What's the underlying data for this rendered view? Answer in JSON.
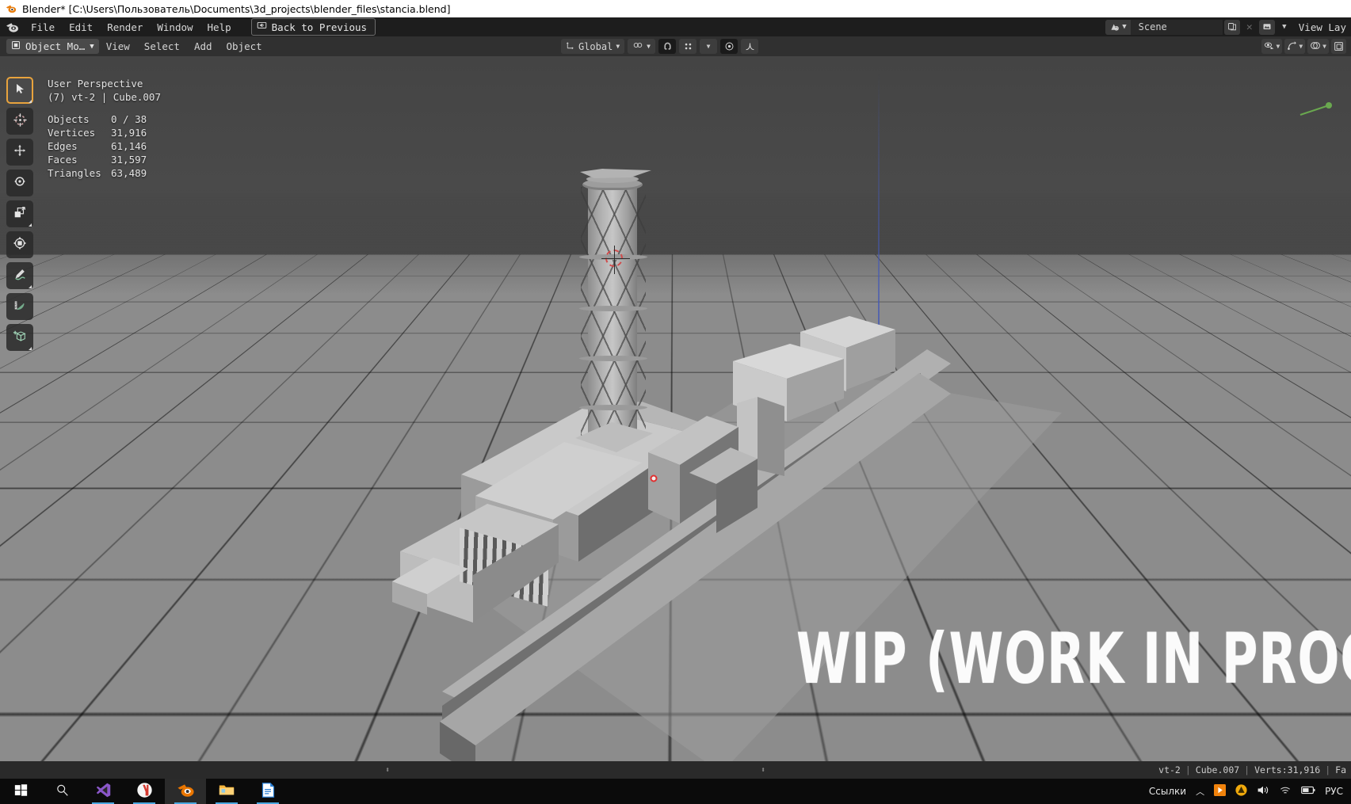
{
  "window": {
    "title": "Blender* [C:\\Users\\Пользователь\\Documents\\3d_projects\\blender_files\\stancia.blend]",
    "app_icon": "blender-logo-icon"
  },
  "topbar": {
    "logo_icon": "blender-logo-icon",
    "menus": [
      "File",
      "Edit",
      "Render",
      "Window",
      "Help"
    ],
    "back_button": {
      "label": "Back to Previous",
      "icon": "back-arrow-icon"
    },
    "scene": {
      "icon": "scene-icon",
      "dropdown_icon": "chevron-down-icon",
      "name": "Scene",
      "new_icon": "copy-icon",
      "remove_icon": "close-x-icon"
    },
    "view_layer": {
      "icon": "view-layer-icon",
      "dropdown_icon": "chevron-down-icon",
      "name": "View Lay"
    }
  },
  "viewport_header": {
    "mode": {
      "icon": "object-mode-icon",
      "label": "Object Mo…",
      "dropdown_icon": "chevron-down-icon"
    },
    "menus": [
      "View",
      "Select",
      "Add",
      "Object"
    ],
    "right_controls": [
      {
        "name": "visibility-icon",
        "dropdown": true
      },
      {
        "name": "gizmo-icon",
        "dropdown": true
      },
      {
        "name": "overlays-icon",
        "dropdown": true
      },
      {
        "name": "xray-toggle-icon",
        "dropdown": false
      }
    ]
  },
  "transform_bar": {
    "orientation_icon": "transform-orientation-icon",
    "orientation": "Global",
    "orientation_dropdown_icon": "chevron-down-icon",
    "pivot_icon": "pivot-point-icon",
    "pivot_dropdown_icon": "chevron-down-icon",
    "snap_magnet_icon": "snap-magnet-icon",
    "snap_target_icon": "snap-target-icon",
    "snap_dropdown_icon": "chevron-down-icon",
    "proportional_icon": "proportional-edit-icon",
    "falloff_icon": "falloff-curve-icon"
  },
  "toolbar": {
    "tools": [
      {
        "name": "tweak-select-box-tool",
        "icon": "cursor-arrow-icon",
        "active": true,
        "has_submenu": true
      },
      {
        "name": "cursor-tool",
        "icon": "3d-cursor-icon",
        "active": false,
        "has_submenu": false
      },
      {
        "name": "move-tool",
        "icon": "move-arrows-icon",
        "active": false,
        "has_submenu": false
      },
      {
        "name": "rotate-tool",
        "icon": "rotate-icon",
        "active": false,
        "has_submenu": false
      },
      {
        "name": "scale-tool",
        "icon": "scale-icon",
        "active": false,
        "has_submenu": true
      },
      {
        "name": "transform-tool",
        "icon": "transform-icon",
        "active": false,
        "has_submenu": false
      },
      {
        "name": "annotate-tool",
        "icon": "annotate-pen-icon",
        "active": false,
        "has_submenu": true
      },
      {
        "name": "measure-tool",
        "icon": "measure-ruler-icon",
        "active": false,
        "has_submenu": false
      },
      {
        "name": "add-cube-tool",
        "icon": "add-cube-icon",
        "active": false,
        "has_submenu": true
      }
    ]
  },
  "viewport_info": {
    "perspective": "User Perspective",
    "collection_line": "(7) vt-2 | Cube.007",
    "stats": [
      {
        "label": "Objects",
        "value": "0 / 38"
      },
      {
        "label": "Vertices",
        "value": "31,916"
      },
      {
        "label": "Edges",
        "value": "61,146"
      },
      {
        "label": "Faces",
        "value": "31,597"
      },
      {
        "label": "Triangles",
        "value": "63,489"
      }
    ]
  },
  "scene_content": {
    "watermark": "WIP (WORK IN PROGRESS)",
    "description": "Grey low-poly nuclear power-station model: tall latticed chimney stack, long main reactor hall building, turbine hall with column row, several cuboid outbuildings and a long wall / road, on a grey perspective grid floor."
  },
  "status_bar": {
    "object_name": "vt-2",
    "mesh_name": "Cube.007",
    "verts": "Verts:31,916",
    "faces_partial": "Fa",
    "separator": "|"
  },
  "taskbar": {
    "items": [
      {
        "name": "start-button",
        "icon": "windows-logo-icon"
      },
      {
        "name": "search-button",
        "icon": "search-icon"
      },
      {
        "name": "vscode-button",
        "icon": "vscode-icon",
        "running": true
      },
      {
        "name": "yandex-browser-button",
        "icon": "yandex-icon",
        "running": true
      },
      {
        "name": "blender-button",
        "icon": "blender-logo-icon",
        "running": true,
        "focused": true
      },
      {
        "name": "file-explorer-button",
        "icon": "folder-icon",
        "running": true
      },
      {
        "name": "libreoffice-button",
        "icon": "document-icon",
        "running": true
      }
    ],
    "tray": {
      "label": "Ссылки",
      "chevron_icon": "chevron-up-icon",
      "icons": [
        "media-player-icon",
        "warning-triangle-icon",
        "volume-icon",
        "wifi-icon",
        "battery-icon"
      ],
      "language": "РУС"
    }
  },
  "colors": {
    "blender_orange": "#e87d0d",
    "panel_dark": "#1d1d1d",
    "header_grey": "#303030",
    "viewport_floor": "#8c8c8c",
    "accent_blue": "#4772b3",
    "cursor_red": "#d14b4b",
    "axis_green": "#5a8c46",
    "axis_red": "#b04848",
    "axis_blue": "#465ab4"
  }
}
